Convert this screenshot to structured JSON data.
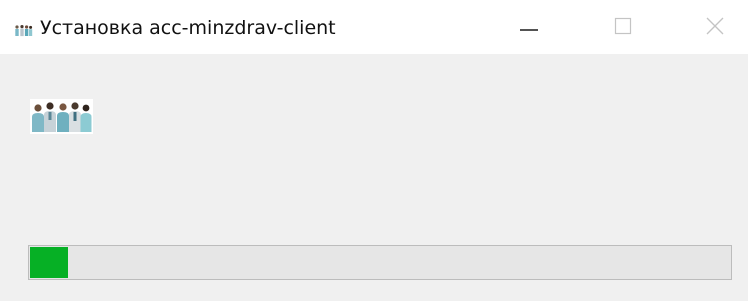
{
  "window": {
    "title": "Установка acc-minzdrav-client",
    "icon": "doctors-icon",
    "controls": {
      "minimize": "minimize-icon",
      "maximize": "maximize-icon",
      "close": "close-icon"
    }
  },
  "main": {
    "image": "doctors-group-icon"
  },
  "progress": {
    "value": 0.054,
    "color": "#06b025"
  }
}
